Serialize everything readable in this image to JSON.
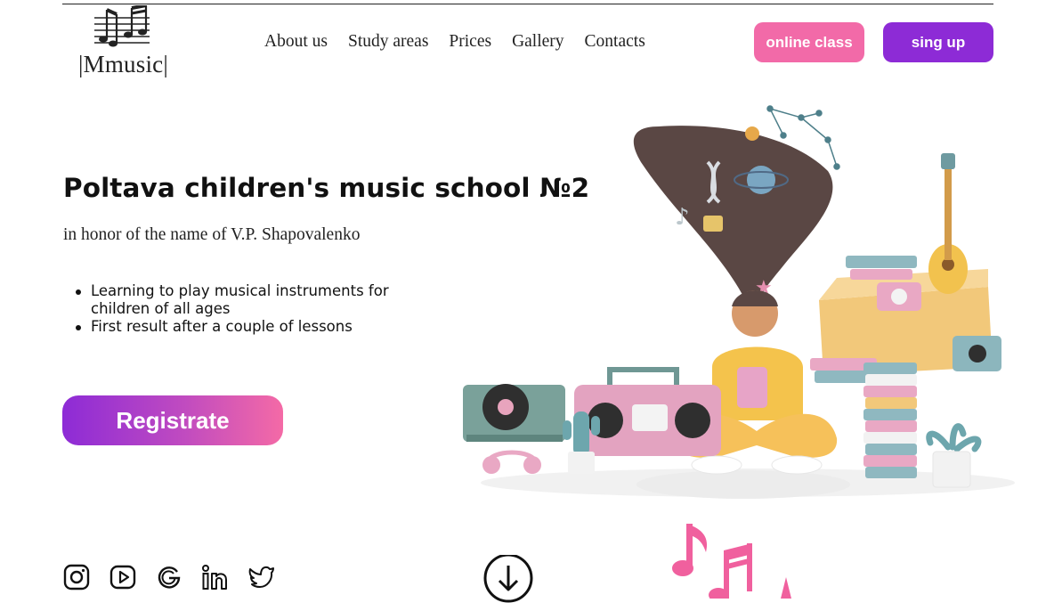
{
  "logo": {
    "text": "|Mmusic|",
    "icon": "music-notes-icon"
  },
  "nav": {
    "items": [
      {
        "label": "About us"
      },
      {
        "label": "Study areas"
      },
      {
        "label": "Prices"
      },
      {
        "label": "Gallery"
      },
      {
        "label": "Contacts"
      }
    ]
  },
  "header_buttons": {
    "online_class": "online class",
    "sign_up": "sing up"
  },
  "hero": {
    "title": "Poltava children's music school №2",
    "subtitle": "in honor of the name of V.P. Shapovalenko",
    "bullets": [
      "Learning to play musical instruments for children of all ages",
      "First result after a couple of lessons"
    ],
    "cta": "Registrate"
  },
  "socials": [
    {
      "icon": "instagram-icon"
    },
    {
      "icon": "youtube-icon"
    },
    {
      "icon": "google-icon"
    },
    {
      "icon": "linkedin-icon"
    },
    {
      "icon": "twitter-icon"
    }
  ],
  "colors": {
    "accent_pink": "#f26aa8",
    "accent_purple": "#8d2bd6"
  }
}
